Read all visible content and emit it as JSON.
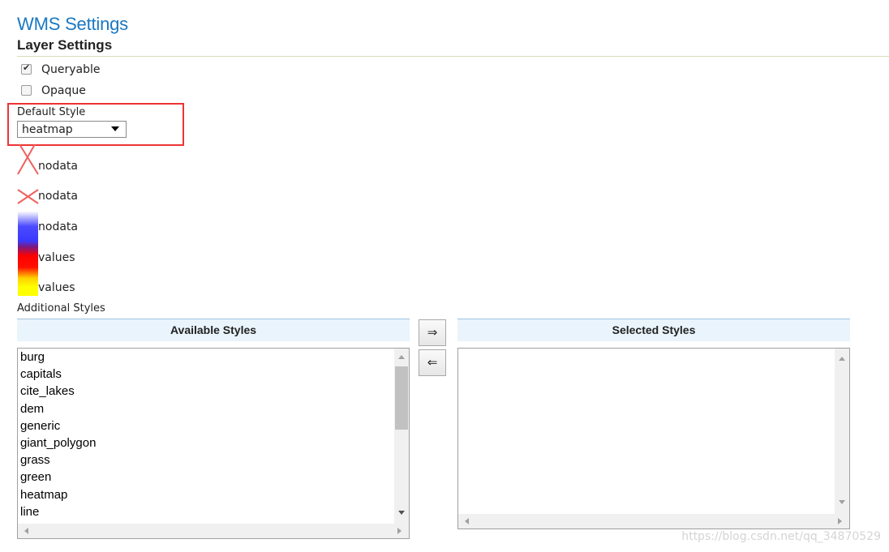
{
  "header": {
    "title": "WMS Settings",
    "subtitle": "Layer Settings"
  },
  "layer_settings": {
    "queryable": {
      "label": "Queryable",
      "checked": true
    },
    "opaque": {
      "label": "Opaque",
      "checked": false
    },
    "default_style": {
      "label": "Default Style",
      "value": "heatmap"
    }
  },
  "legend": {
    "entries": [
      {
        "label": "nodata",
        "icon": "red-x-icon"
      },
      {
        "label": "nodata",
        "icon": "red-x-icon"
      },
      {
        "label": "nodata",
        "color": "#3b3bff"
      },
      {
        "label": "values",
        "color": "#ff0000"
      },
      {
        "label": "values",
        "color": "#ffff00"
      }
    ]
  },
  "additional_styles": {
    "label": "Additional Styles",
    "available_header": "Available Styles",
    "selected_header": "Selected Styles",
    "available": [
      "burg",
      "capitals",
      "cite_lakes",
      "dem",
      "generic",
      "giant_polygon",
      "grass",
      "green",
      "heatmap",
      "line"
    ],
    "selected": [],
    "add_icon": "⇒",
    "remove_icon": "⇐"
  },
  "watermark": "https://blog.csdn.net/qq_34870529",
  "colors": {
    "title": "#1a78c2",
    "highlight": "#e33333",
    "header_bg": "#eaf4fc"
  }
}
